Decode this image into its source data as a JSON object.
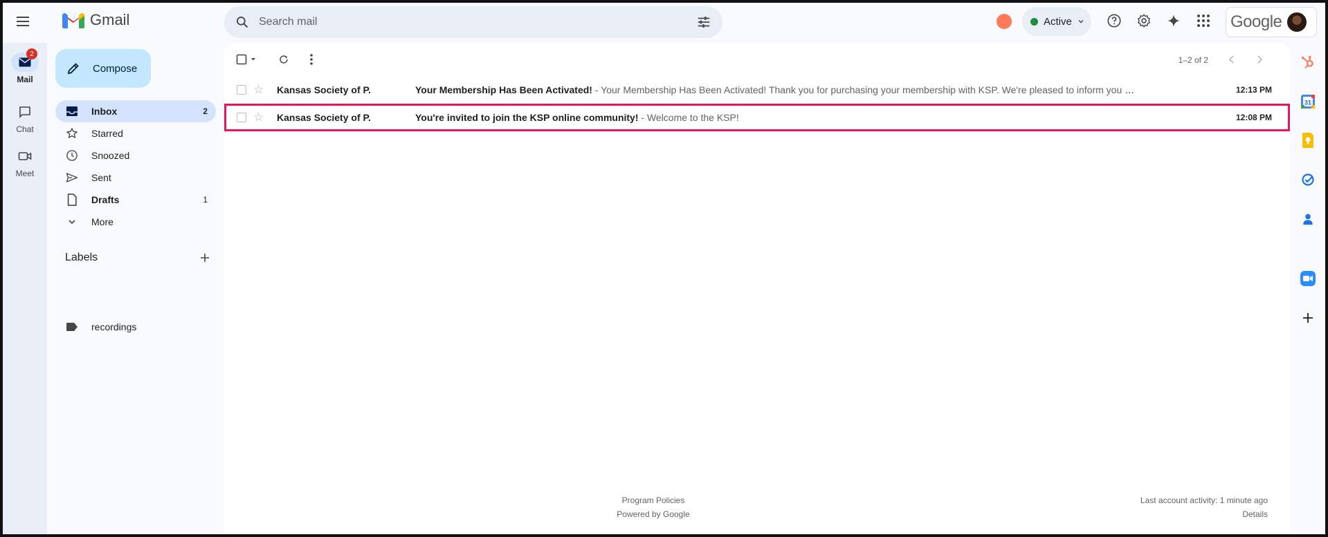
{
  "app": {
    "name": "Gmail"
  },
  "search": {
    "placeholder": "Search mail"
  },
  "header": {
    "status_label": "Active",
    "google_word": "Google"
  },
  "rail": {
    "mail_label": "Mail",
    "mail_badge": "2",
    "chat_label": "Chat",
    "meet_label": "Meet"
  },
  "nav": {
    "compose_label": "Compose",
    "items": [
      {
        "label": "Inbox",
        "count": "2"
      },
      {
        "label": "Starred",
        "count": ""
      },
      {
        "label": "Snoozed",
        "count": ""
      },
      {
        "label": "Sent",
        "count": ""
      },
      {
        "label": "Drafts",
        "count": "1"
      },
      {
        "label": "More",
        "count": ""
      }
    ],
    "labels_heading": "Labels",
    "labels": [
      "recordings"
    ]
  },
  "toolbar": {
    "pager_text": "1–2 of 2"
  },
  "emails": [
    {
      "sender": "Kansas Society of P.",
      "subject": "Your Membership Has Been Activated!",
      "snippet": " - Your Membership Has Been Activated! Thank you for purchasing your membership with KSP. We're pleased to inform you that your me...",
      "time": "12:13 PM"
    },
    {
      "sender": "Kansas Society of P.",
      "subject": "You're invited to join the KSP online community!",
      "snippet": " - Welcome to the KSP!",
      "time": "12:08 PM"
    }
  ],
  "footer": {
    "program_policies": "Program Policies",
    "powered_by": "Powered by Google",
    "last_activity": "Last account activity: 1 minute ago",
    "details": "Details"
  },
  "colors": {
    "highlight": "#e8175d",
    "accent": "#0b57d0",
    "active_nav": "#d3e3fd",
    "compose_bg": "#c2e7ff"
  }
}
